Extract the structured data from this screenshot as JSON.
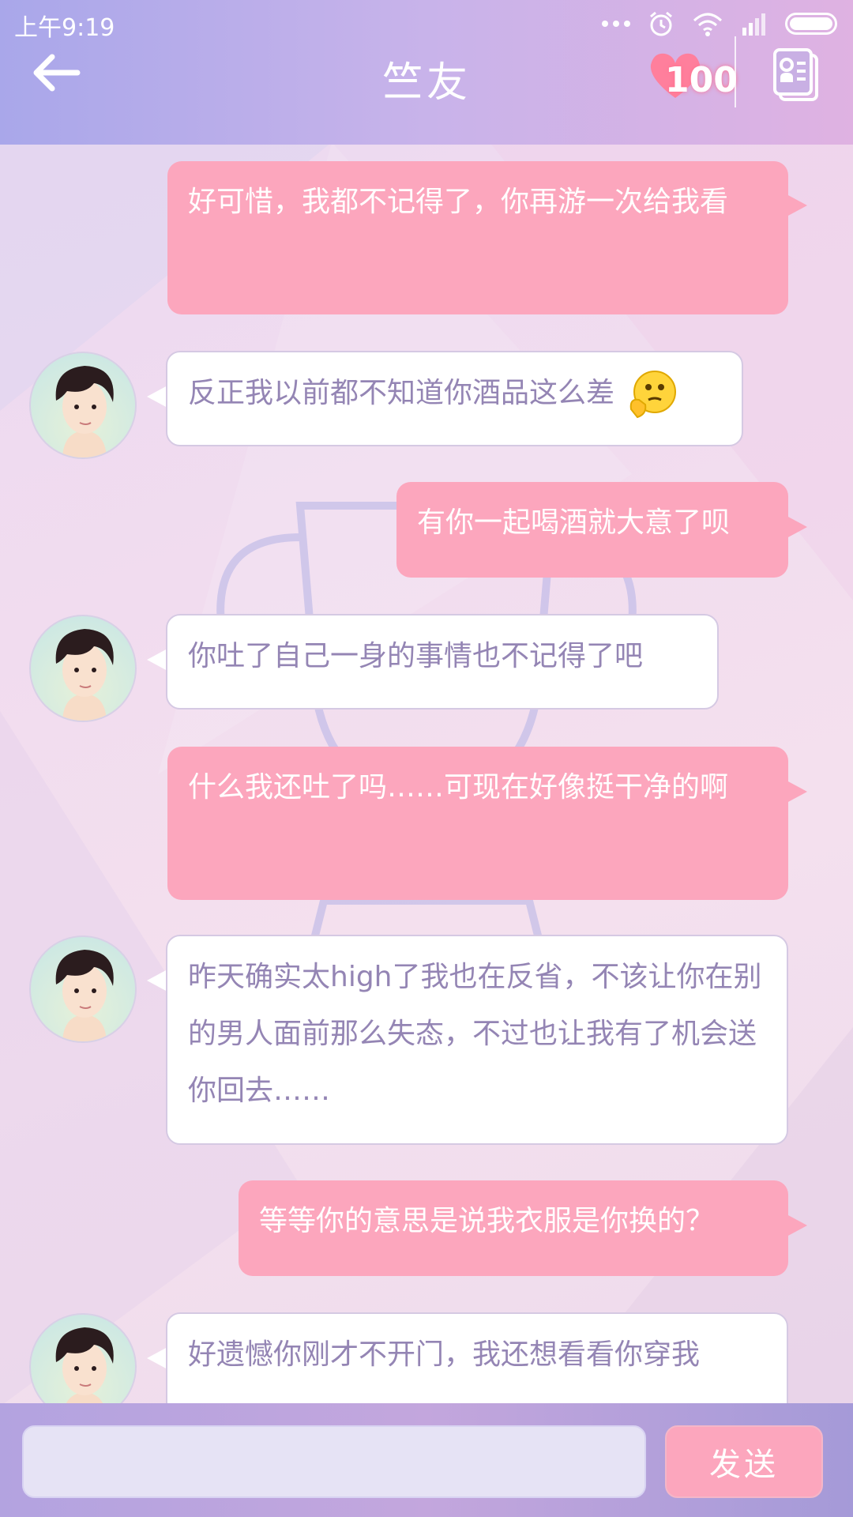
{
  "status_bar": {
    "time": "上午9:19"
  },
  "header": {
    "title": "竺友",
    "affection_value": "100",
    "icons": [
      "back-arrow-icon",
      "heart-icon",
      "contact-card-icon"
    ]
  },
  "messages": [
    {
      "sender": "me",
      "text": "好可惜，我都不记得了，你再游一次给我看"
    },
    {
      "sender": "them",
      "text": "反正我以前都不知道你酒品这么差",
      "emoji": "thinking-emoji"
    },
    {
      "sender": "me",
      "text": "有你一起喝酒就大意了呗"
    },
    {
      "sender": "them",
      "text": "你吐了自己一身的事情也不记得了吧"
    },
    {
      "sender": "me",
      "text": "什么我还吐了吗……可现在好像挺干净的啊"
    },
    {
      "sender": "them",
      "text": "昨天确实太high了我也在反省，不该让你在别的男人面前那么失态，不过也让我有了机会送你回去……"
    },
    {
      "sender": "me",
      "text": "等等你的意思是说我衣服是你换的？"
    },
    {
      "sender": "them",
      "text": "好遗憾你刚才不开门，我还想看看你穿我"
    }
  ],
  "input_bar": {
    "placeholder": "",
    "send_label": "发送"
  },
  "colors": {
    "header_gradient_start": "#a9a7ea",
    "header_gradient_end": "#dfb2e2",
    "my_bubble": "#fca6bd",
    "their_text": "#9485b4",
    "send_button": "#fca6bd"
  }
}
